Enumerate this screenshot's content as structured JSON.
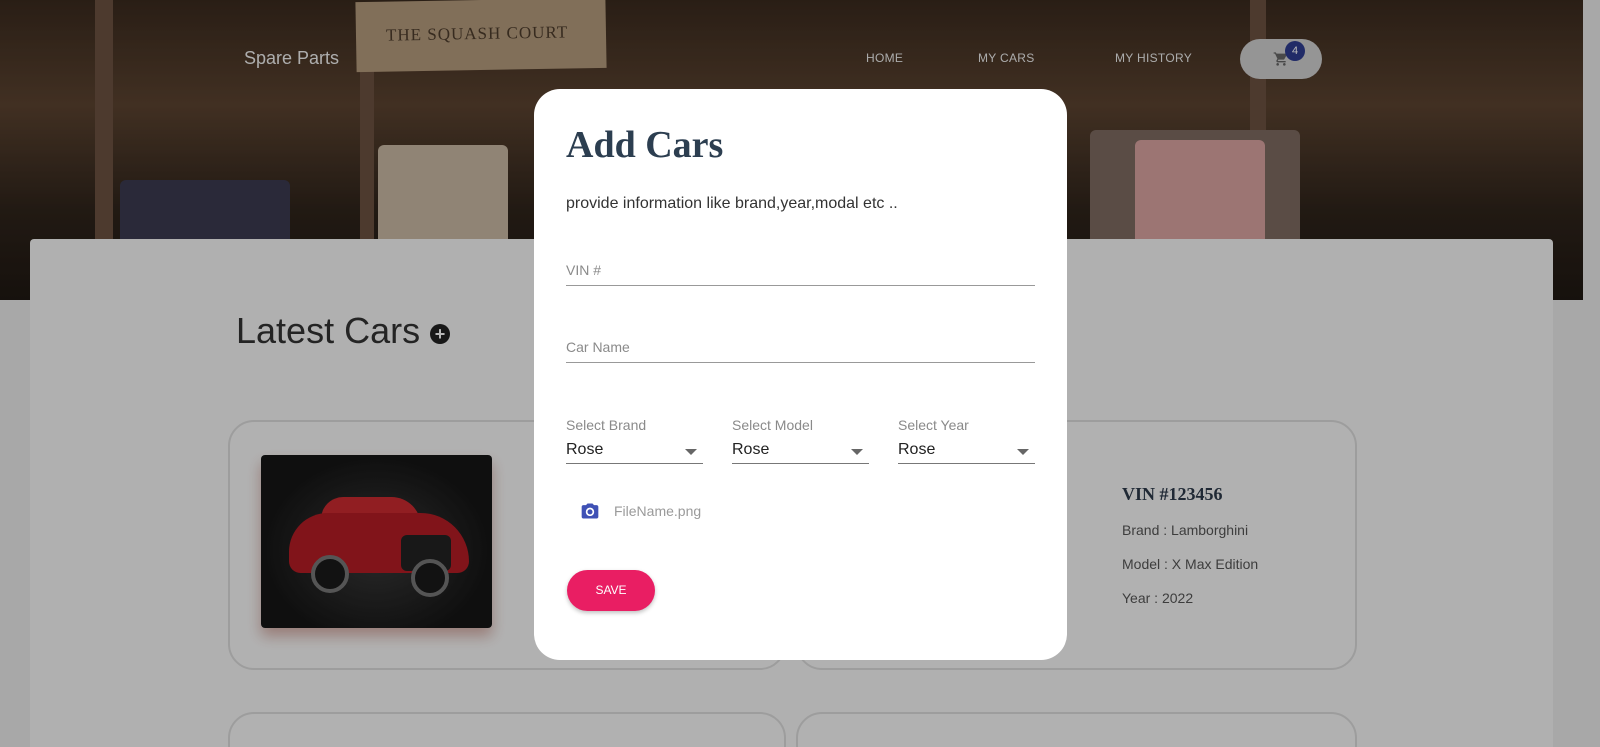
{
  "header": {
    "brand": "Spare Parts",
    "nav": [
      "HOME",
      "MY CARS",
      "MY HISTORY"
    ],
    "cart_count": "4",
    "hero_tag_text": "THE SQUASH COURT"
  },
  "main": {
    "section_title": "Latest Cars",
    "card": {
      "vin": "VIN #123456",
      "brand_line": "Brand : Lamborghini",
      "model_line": "Model : X Max Edition",
      "year_line": "Year : 2022"
    }
  },
  "modal": {
    "title": "Add Cars",
    "subtitle": "provide information like brand,year,modal etc ..",
    "vin_placeholder": "VIN #",
    "car_name_placeholder": "Car Name",
    "selects": [
      {
        "label": "Select Brand",
        "value": "Rose"
      },
      {
        "label": "Select Model",
        "value": "Rose"
      },
      {
        "label": "Select Year",
        "value": "Rose"
      }
    ],
    "file_name": "FileName.png",
    "save_label": "SAVE"
  },
  "colors": {
    "accent": "#e91e63",
    "badge": "#2f3c8f",
    "title": "#2c3e50"
  }
}
